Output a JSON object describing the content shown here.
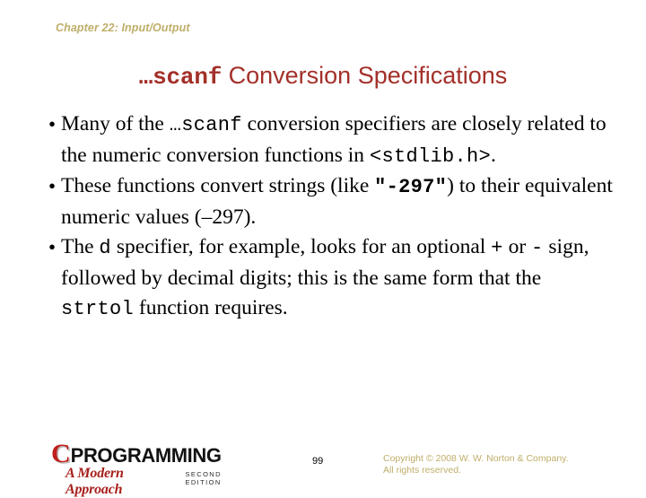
{
  "slide": {
    "chapter_header": "Chapter 22: Input/Output",
    "title": {
      "code_prefix": "…scanf",
      "rest": " Conversion Specifications",
      "color": "#a33029"
    },
    "bullets": [
      {
        "marker": "•",
        "segments": [
          {
            "kind": "text",
            "value": "Many of the "
          },
          {
            "kind": "code",
            "value": "…scanf"
          },
          {
            "kind": "text",
            "value": " conversion specifiers are closely related to the numeric conversion functions in "
          },
          {
            "kind": "code",
            "value": "<stdlib.h>"
          },
          {
            "kind": "text",
            "value": "."
          }
        ]
      },
      {
        "marker": "•",
        "segments": [
          {
            "kind": "text",
            "value": "These functions convert strings (like "
          },
          {
            "kind": "code-bold",
            "value": "\"-297\""
          },
          {
            "kind": "text",
            "value": ") to their equivalent numeric values (–297)."
          }
        ]
      },
      {
        "marker": "•",
        "segments": [
          {
            "kind": "text",
            "value": "The "
          },
          {
            "kind": "code",
            "value": "d"
          },
          {
            "kind": "text",
            "value": " specifier, for example, looks for an optional "
          },
          {
            "kind": "code",
            "value": "+"
          },
          {
            "kind": "text",
            "value": " or "
          },
          {
            "kind": "code",
            "value": "-"
          },
          {
            "kind": "text",
            "value": " sign, followed by decimal digits; this is the same form that the "
          },
          {
            "kind": "code",
            "value": "strtol"
          },
          {
            "kind": "text",
            "value": " function requires."
          }
        ]
      }
    ],
    "footer": {
      "logo": {
        "c_letter": "C",
        "wordmark": "PROGRAMMING",
        "subtitle": "A Modern Approach",
        "edition": "SECOND EDITION",
        "c_color": "#c0201c"
      },
      "page_number": "99",
      "copyright_line1": "Copyright © 2008 W. W. Norton & Company.",
      "copyright_line2": "All rights reserved."
    },
    "colors": {
      "background": "#ffffff",
      "header_tan": "#bfae69",
      "title_red": "#a33029",
      "body_black": "#000000"
    }
  }
}
